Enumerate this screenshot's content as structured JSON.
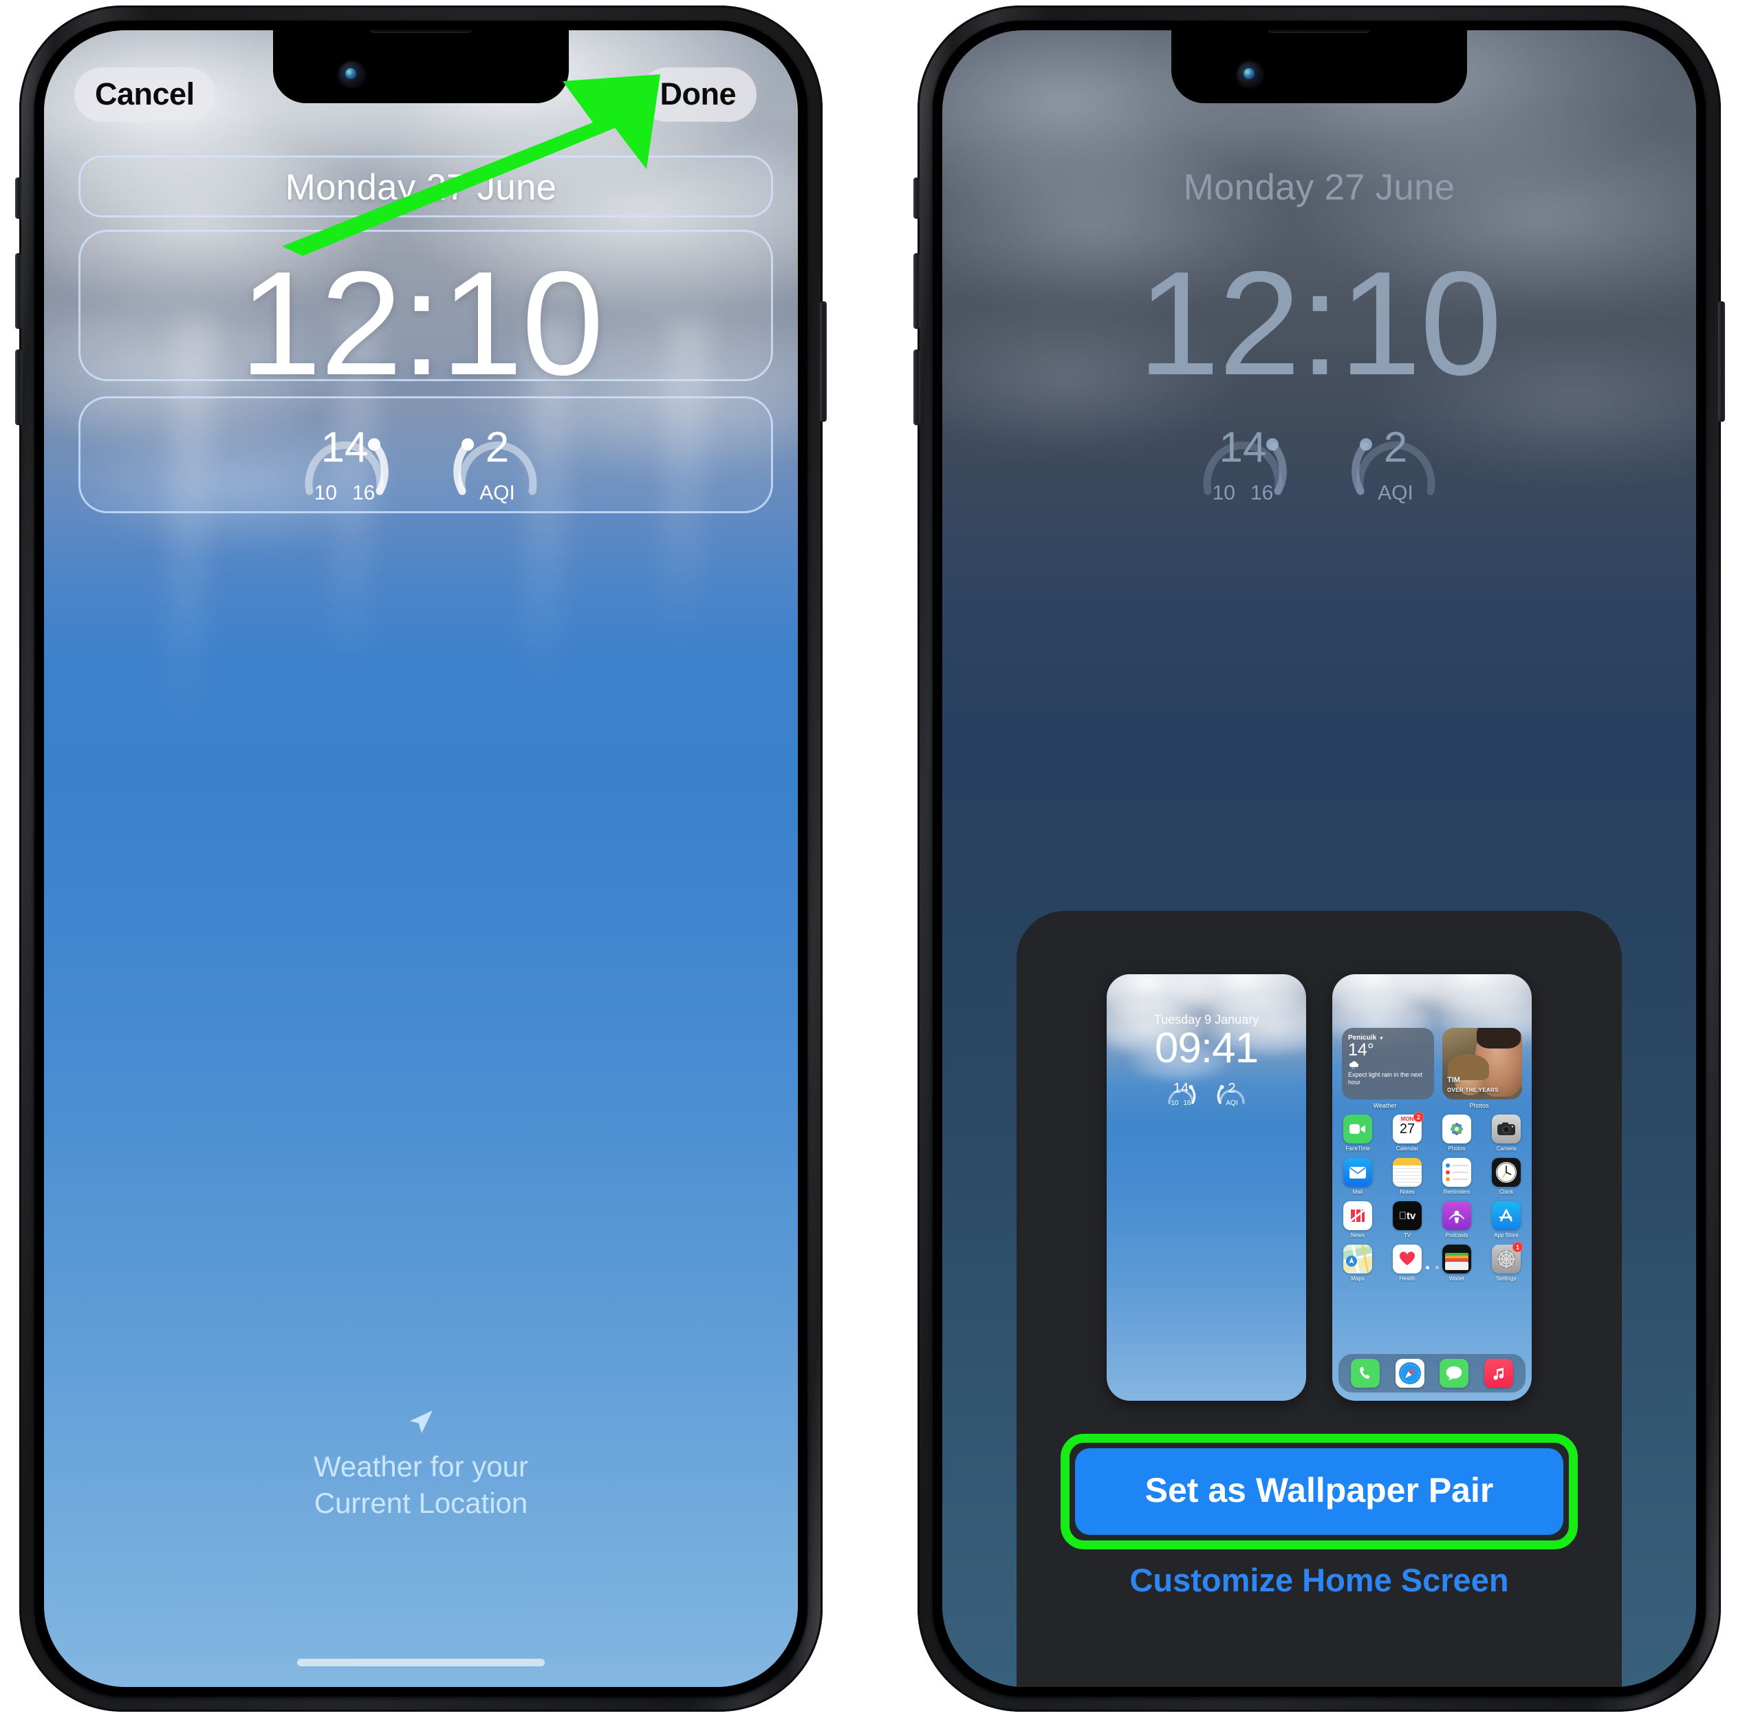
{
  "annotation": {
    "arrow_color": "#17ec17",
    "highlight_color": "#17ec17"
  },
  "left_phone": {
    "name": "wallpaper-editor",
    "toolbar": {
      "cancel_label": "Cancel",
      "done_label": "Done"
    },
    "lock_screen": {
      "date": "Monday 27 June",
      "time": "12:10",
      "widgets": [
        {
          "name": "temperature-gauge",
          "value": "14",
          "low": "10",
          "high": "16"
        },
        {
          "name": "air-quality-gauge",
          "value": "2",
          "unit": "AQI"
        }
      ],
      "footer": {
        "icon": "location-arrow-icon",
        "line1": "Weather for your",
        "line2": "Current Location"
      }
    }
  },
  "right_phone": {
    "name": "wallpaper-set-confirmation",
    "lock_screen": {
      "date": "Monday 27 June",
      "time": "12:10",
      "widgets": [
        {
          "name": "temperature-gauge",
          "value": "14",
          "low": "10",
          "high": "16"
        },
        {
          "name": "air-quality-gauge",
          "value": "2",
          "unit": "AQI"
        }
      ]
    },
    "sheet": {
      "lock_preview": {
        "date": "Tuesday 9 January",
        "time": "09:41",
        "widgets": [
          {
            "value": "14",
            "low": "10",
            "high": "16"
          },
          {
            "value": "2",
            "unit": "AQI"
          }
        ]
      },
      "home_preview": {
        "weather_widget": {
          "location": "Penicuik",
          "temperature": "14°",
          "icon": "rain-cloud-icon",
          "description": "Expect light rain in the next hour",
          "label": "Weather"
        },
        "photos_widget": {
          "title": "TIM",
          "subtitle": "OVER THE YEARS",
          "label": "Photos"
        },
        "app_rows": [
          [
            {
              "name": "FaceTime",
              "icon": "facetime-icon",
              "badge": ""
            },
            {
              "name": "Calendar",
              "icon": "calendar-icon",
              "badge": "2",
              "day_name": "MON",
              "day_num": "27"
            },
            {
              "name": "Photos",
              "icon": "photos-icon",
              "badge": ""
            },
            {
              "name": "Camera",
              "icon": "camera-icon",
              "badge": ""
            }
          ],
          [
            {
              "name": "Mail",
              "icon": "mail-icon",
              "badge": ""
            },
            {
              "name": "Notes",
              "icon": "notes-icon",
              "badge": ""
            },
            {
              "name": "Reminders",
              "icon": "reminders-icon",
              "badge": ""
            },
            {
              "name": "Clock",
              "icon": "clock-icon",
              "badge": ""
            }
          ],
          [
            {
              "name": "News",
              "icon": "news-icon",
              "badge": ""
            },
            {
              "name": "TV",
              "icon": "tv-icon",
              "badge": ""
            },
            {
              "name": "Podcasts",
              "icon": "podcasts-icon",
              "badge": ""
            },
            {
              "name": "App Store",
              "icon": "appstore-icon",
              "badge": ""
            }
          ],
          [
            {
              "name": "Maps",
              "icon": "maps-icon",
              "badge": ""
            },
            {
              "name": "Health",
              "icon": "health-icon",
              "badge": ""
            },
            {
              "name": "Wallet",
              "icon": "wallet-icon",
              "badge": ""
            },
            {
              "name": "Settings",
              "icon": "settings-icon",
              "badge": "1"
            }
          ]
        ],
        "dock": [
          {
            "name": "Phone",
            "icon": "phone-icon"
          },
          {
            "name": "Safari",
            "icon": "safari-icon"
          },
          {
            "name": "Messages",
            "icon": "messages-icon"
          },
          {
            "name": "Music",
            "icon": "music-icon"
          }
        ],
        "page_dots": 2
      },
      "primary_button": "Set as Wallpaper Pair",
      "secondary_link": "Customize Home Screen"
    }
  }
}
